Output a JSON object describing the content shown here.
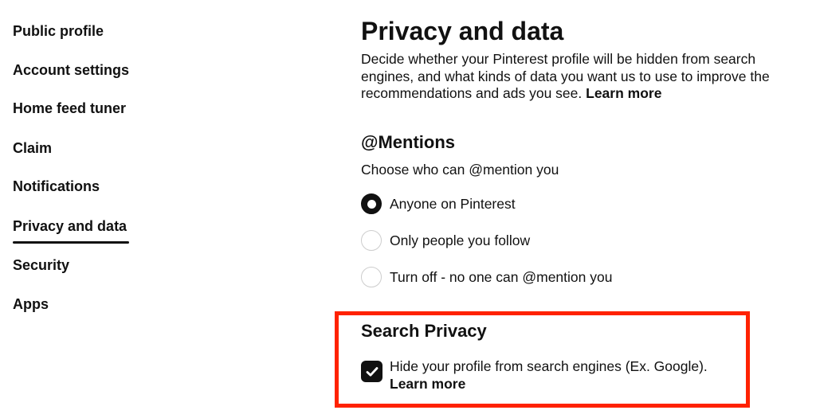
{
  "sidebar": {
    "items": [
      {
        "label": "Public profile"
      },
      {
        "label": "Account settings"
      },
      {
        "label": "Home feed tuner"
      },
      {
        "label": "Claim"
      },
      {
        "label": "Notifications"
      },
      {
        "label": "Privacy and data",
        "active": true
      },
      {
        "label": "Security"
      },
      {
        "label": "Apps"
      }
    ]
  },
  "main": {
    "title": "Privacy and data",
    "description": "Decide whether your Pinterest profile will be hidden from search engines, and what kinds of data you want us to use to improve the recommendations and ads you see.",
    "description_link": "Learn more",
    "mentions": {
      "heading": "@Mentions",
      "subheading": "Choose who can @mention you",
      "options": [
        {
          "label": "Anyone on Pinterest",
          "selected": true
        },
        {
          "label": "Only people you follow",
          "selected": false
        },
        {
          "label": "Turn off - no one can @mention you",
          "selected": false
        }
      ]
    },
    "search_privacy": {
      "heading": "Search Privacy",
      "checkbox_label": "Hide your profile from search engines (Ex. Google).",
      "checkbox_link": "Learn more",
      "checked": true
    }
  },
  "colors": {
    "highlight_border": "#ff2200",
    "text": "#111111",
    "radio_border": "#cdcdcd"
  },
  "icons": {
    "checkbox": "check-icon"
  }
}
